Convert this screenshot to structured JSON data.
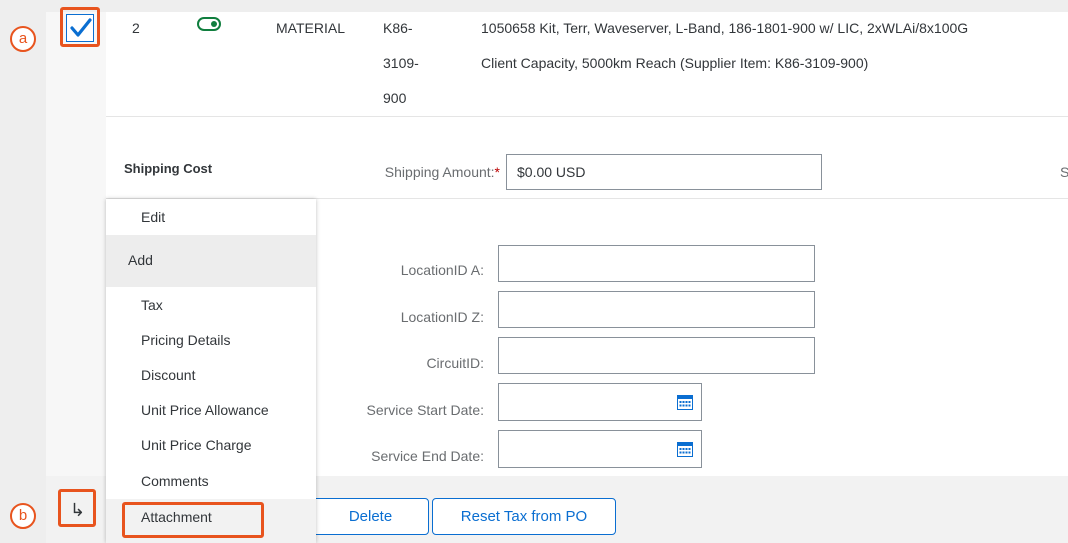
{
  "callouts": {
    "a": "a",
    "b": "b"
  },
  "row": {
    "number": "2",
    "type": "MATERIAL",
    "part_line1": "K86-",
    "part_line2": "3109-",
    "part_line3": "900",
    "desc_line1": "1050658 Kit, Terr, Waveserver, L-Band, 186-1801-900 w/ LIC, 2xWLAi/8x100G",
    "desc_line2": "Client Capacity, 5000km Reach (Supplier Item: K86-3109-900)"
  },
  "shipping": {
    "section_label": "Shipping Cost",
    "amount_label": "Shipping Amount:",
    "required_mark": "*",
    "amount_value": "$0.00 USD",
    "clipped_label": "S"
  },
  "fields": {
    "location_a_label": "LocationID A:",
    "location_z_label": "LocationID Z:",
    "circuit_label": "CircuitID:",
    "start_date_label": "Service Start Date:",
    "end_date_label": "Service End Date:"
  },
  "menu": {
    "edit": "Edit",
    "add": "Add",
    "items": [
      "Tax",
      "Pricing Details",
      "Discount",
      "Unit Price Allowance",
      "Unit Price Charge",
      "Comments",
      "Attachment"
    ]
  },
  "footer": {
    "arrow": "↳",
    "delete_label": "Delete",
    "reset_label": "Reset Tax from PO"
  },
  "icons": {
    "checkbox": "checkmark-icon",
    "toggle": "toggle-on-icon",
    "calendar": "calendar-icon",
    "arrow": "return-arrow-icon"
  },
  "colors": {
    "accent": "#0a6ed1",
    "highlight": "#e8541e",
    "toggle": "#107e3e"
  }
}
